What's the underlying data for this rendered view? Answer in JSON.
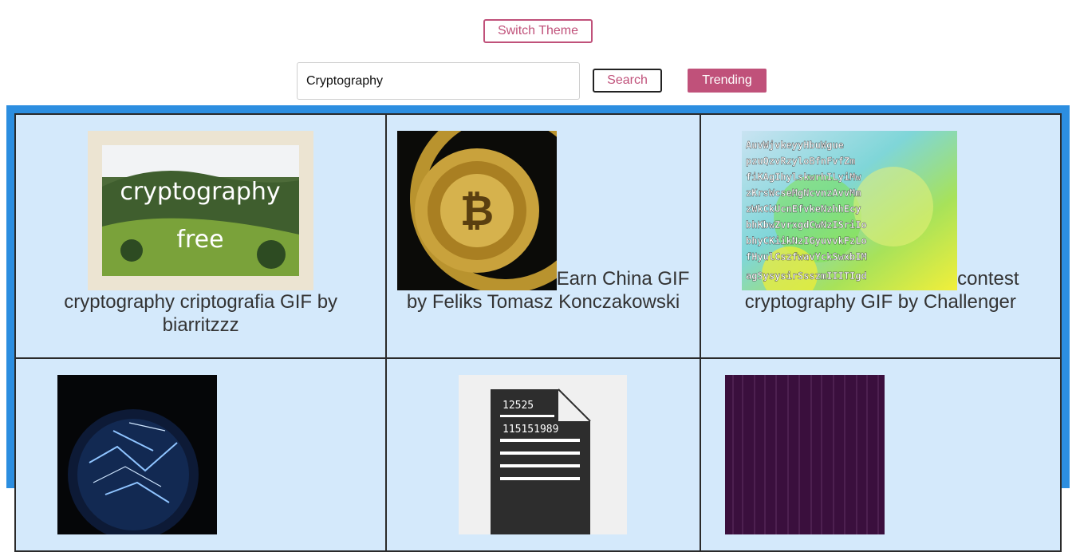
{
  "header": {
    "switch_theme_label": "Switch Theme",
    "search_value": "Cryptography",
    "search_label": "Search",
    "trending_label": "Trending"
  },
  "colors": {
    "accent": "#c0517a",
    "frame": "#2c8ee0",
    "cell_bg": "#d4e9fb"
  },
  "results": [
    {
      "title": "cryptography criptografia GIF by biarritzzz",
      "thumb_text_1": "cryptography",
      "thumb_text_2": "free"
    },
    {
      "title": "Earn China GIF by Feliks Tomasz Konczakowski"
    },
    {
      "title": "contest cryptography GIF by Challenger"
    },
    {
      "title": ""
    },
    {
      "title": "",
      "thumb_text_1": "12525",
      "thumb_text_2": "115151989"
    },
    {
      "title": ""
    }
  ]
}
